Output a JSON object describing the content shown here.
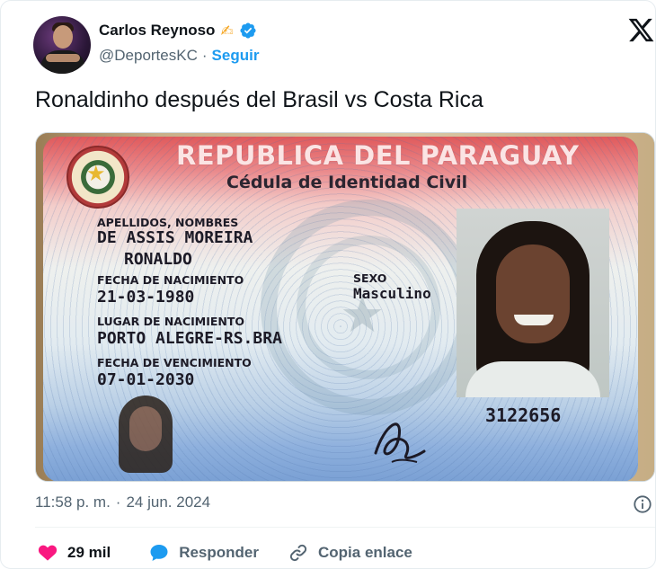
{
  "author": {
    "display_name": "Carlos Reynoso",
    "emoji": "✍",
    "handle": "@DeportesKC",
    "separator": "·",
    "follow_label": "Seguir"
  },
  "tweet": {
    "text": "Ronaldinho después del Brasil vs Costa Rica"
  },
  "id_card": {
    "title": "REPUBLICA DEL PARAGUAY",
    "subtitle": "Cédula de Identidad Civil",
    "names_label": "APELLIDOS, NOMBRES",
    "surname": "DE ASSIS MOREIRA",
    "given_name": "RONALDO",
    "birth_date_label": "FECHA DE NACIMIENTO",
    "birth_date": "21-03-1980",
    "birth_place_label": "LUGAR DE NACIMIENTO",
    "birth_place": "PORTO ALEGRE-RS.BRA",
    "expiry_label": "FECHA DE VENCIMIENTO",
    "expiry_date": "07-01-2030",
    "sex_label": "SEXO",
    "sex": "Masculino",
    "document_number": "3122656"
  },
  "meta": {
    "time": "11:58 p. m.",
    "separator": "·",
    "date": "24 jun. 2024"
  },
  "actions": {
    "like_count": "29 mil",
    "reply_label": "Responder",
    "copy_label": "Copia enlace"
  },
  "colors": {
    "accent": "#1d9bf0",
    "like": "#f91880",
    "text_secondary": "#536471"
  }
}
